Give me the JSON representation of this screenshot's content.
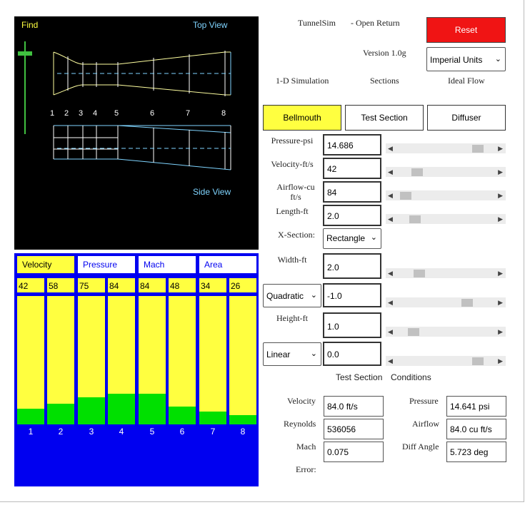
{
  "tunnel_view": {
    "find_label": "Find",
    "top_view_label": "Top View",
    "side_view_label": "Side View",
    "stations": [
      "1",
      "2",
      "3",
      "4",
      "5",
      "6",
      "7",
      "8"
    ]
  },
  "gauges": {
    "tabs": [
      "Velocity",
      "Pressure",
      "Mach",
      "Area"
    ],
    "active_tab": "Velocity",
    "values": [
      "42",
      "58",
      "75",
      "84",
      "84",
      "48",
      "34",
      "26"
    ],
    "bar_levels": [
      0.12,
      0.16,
      0.21,
      0.24,
      0.24,
      0.14,
      0.1,
      0.07
    ],
    "indices": [
      "1",
      "2",
      "3",
      "4",
      "5",
      "6",
      "7",
      "8"
    ]
  },
  "header": {
    "app_name": "TunnelSim",
    "mode": "- Open Return",
    "reset_label": "Reset",
    "version": "Version 1.0g",
    "units_select": "Imperial Units",
    "simulation": "1-D Simulation",
    "sections": "Sections",
    "ideal_flow": "Ideal Flow"
  },
  "tabs": {
    "bellmouth": "Bellmouth",
    "test_section": "Test Section",
    "diffuser": "Diffuser",
    "active": "Bellmouth"
  },
  "inputs": {
    "pressure": {
      "label": "Pressure-psi",
      "value": "14.686",
      "slider_level": 0.86
    },
    "velocity": {
      "label": "Velocity-ft/s",
      "value": "42",
      "slider_level": 0.18
    },
    "airflow": {
      "label": "Airflow-cu ft/s",
      "value": "84",
      "slider_level": 0.05
    },
    "length": {
      "label": "Length-ft",
      "value": "2.0",
      "slider_level": 0.15
    },
    "xsection": {
      "label": "X-Section:",
      "value": "Rectangle"
    },
    "width": {
      "label": "Width-ft",
      "value": "2.0",
      "slider_level": 0.2
    },
    "width_shape": {
      "select": "Quadratic",
      "value": "-1.0",
      "slider_level": 0.74
    },
    "height": {
      "label": "Height-ft",
      "value": "1.0",
      "slider_level": 0.14
    },
    "height_shape": {
      "select": "Linear",
      "value": "0.0",
      "slider_level": 0.86
    }
  },
  "conditions": {
    "heading_left": "Test Section",
    "heading_right": "Conditions",
    "velocity": {
      "label": "Velocity",
      "value": "84.0 ft/s"
    },
    "reynolds": {
      "label": "Reynolds",
      "value": "536056"
    },
    "mach": {
      "label": "Mach",
      "value": "0.075"
    },
    "pressure": {
      "label": "Pressure",
      "value": "14.641 psi"
    },
    "airflow": {
      "label": "Airflow",
      "value": "84.0 cu ft/s"
    },
    "diff_angle": {
      "label": "Diff Angle",
      "value": "5.723 deg"
    },
    "error_label": "Error:"
  },
  "colors": {
    "panel_bg": "#000000",
    "gauge_bg": "#0000f0",
    "active_yellow": "#ffff40",
    "bar_green": "#00e000",
    "reset_red": "#f01414",
    "tunnel_cyan": "#7fd4ff",
    "bellmouth_yellow": "#ffffa0"
  },
  "icons": {
    "select_arrow": "chevron-down-icon",
    "slider_left": "left-arrow-icon",
    "slider_right": "right-arrow-icon"
  }
}
